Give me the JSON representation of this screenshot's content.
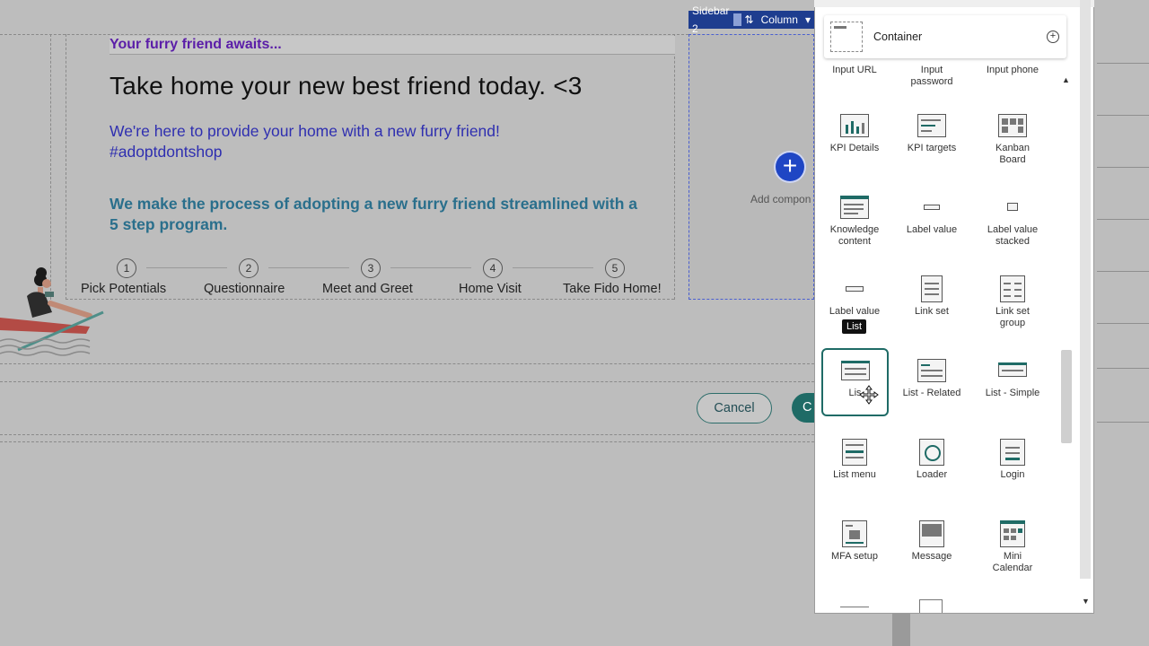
{
  "page": {
    "kicker": "Your furry friend awaits...",
    "headline": "Take home your new best friend today. <3",
    "intro_line1": "We're here to provide your home with a new furry friend!",
    "intro_line2": "#adoptdontshop",
    "process_line1": "We make the process of adopting a new furry friend streamlined with a",
    "process_line2": "5 step program."
  },
  "steps": [
    {
      "num": "1",
      "label": "Pick Potentials"
    },
    {
      "num": "2",
      "label": "Questionnaire"
    },
    {
      "num": "3",
      "label": "Meet and Greet"
    },
    {
      "num": "4",
      "label": "Home Visit"
    },
    {
      "num": "5",
      "label": "Take Fido Home!"
    }
  ],
  "sidebar": {
    "chip_name": "Sidebar 2",
    "chip_layout": "Column",
    "add_label": "Add compon"
  },
  "actions": {
    "cancel": "Cancel",
    "confirm_partial": "C"
  },
  "panel": {
    "container_label": "Container",
    "truncated_row": [
      "Input URL",
      "Input password",
      "Input phone"
    ],
    "components": [
      {
        "label": "KPI Details",
        "icon": "kpi-details-icon"
      },
      {
        "label": "KPI targets",
        "icon": "kpi-targets-icon"
      },
      {
        "label": "Kanban Board",
        "icon": "kanban-board-icon"
      },
      {
        "label": "Knowledge content",
        "icon": "knowledge-content-icon"
      },
      {
        "label": "Label value",
        "icon": "label-value-icon"
      },
      {
        "label": "Label value stacked",
        "icon": "label-value-stacked-icon"
      },
      {
        "label": "Label value",
        "icon": "label-value-inline-icon"
      },
      {
        "label": "Link set",
        "icon": "link-set-icon"
      },
      {
        "label": "Link set group",
        "icon": "link-set-group-icon"
      },
      {
        "label": "List",
        "icon": "list-icon"
      },
      {
        "label": "List - Related",
        "icon": "list-related-icon"
      },
      {
        "label": "List - Simple",
        "icon": "list-simple-icon"
      },
      {
        "label": "List menu",
        "icon": "list-menu-icon"
      },
      {
        "label": "Loader",
        "icon": "loader-icon"
      },
      {
        "label": "Login",
        "icon": "login-icon"
      },
      {
        "label": "MFA setup",
        "icon": "mfa-setup-icon"
      },
      {
        "label": "Message",
        "icon": "message-icon"
      },
      {
        "label": "Mini Calendar",
        "icon": "mini-calendar-icon"
      }
    ],
    "tooltip": "List",
    "list_partial": "Lis"
  }
}
